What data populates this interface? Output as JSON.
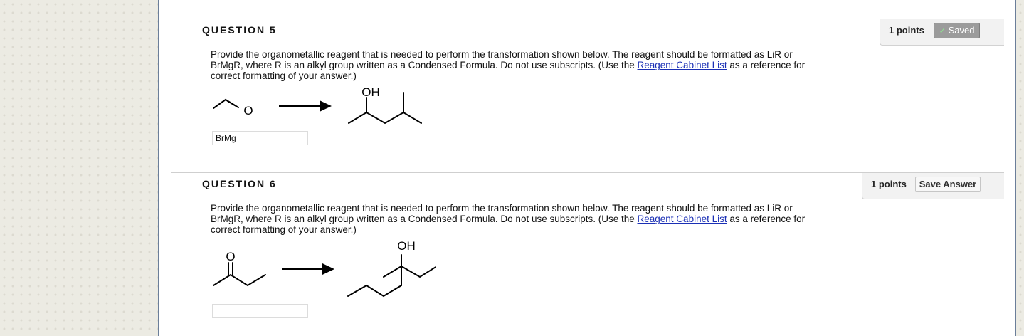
{
  "questions": [
    {
      "title": "QUESTION 5",
      "points_label": "1 points",
      "button_label": "Saved",
      "button_state": "saved",
      "text_before_link": "Provide the organometallic reagent that is needed to perform the transformation shown below. The reagent should be formatted as LiR or BrMgR, where R is an alkyl group written as a Condensed Formula. Do not use subscripts. (Use the ",
      "link_text": "Reagent Cabinet List",
      "text_after_link": " as a reference for correct formatting of your answer.)",
      "reactant_label": "O",
      "product_label": "OH",
      "answer_value": "BrMg"
    },
    {
      "title": "QUESTION 6",
      "points_label": "1 points",
      "button_label": "Save Answer",
      "button_state": "unsaved",
      "text_before_link": "Provide the organometallic reagent that is needed to perform the transformation shown below. The reagent should be formatted as LiR or BrMgR, where R is an alkyl group written as a Condensed Formula. Do not use subscripts. (Use the ",
      "link_text": "Reagent Cabinet List",
      "text_after_link": " as a reference for correct formatting of your answer.)",
      "reactant_label": "O",
      "product_label": "OH",
      "answer_value": ""
    }
  ],
  "icons": {
    "saved_check": "check-icon",
    "reaction_arrow": "right-arrow-icon"
  },
  "colors": {
    "link": "#1a2fb5",
    "saved_button": "#9b9b9b",
    "saved_check": "#8fe08f",
    "panel_border": "#6b7e99",
    "background": "#ecebe3"
  }
}
